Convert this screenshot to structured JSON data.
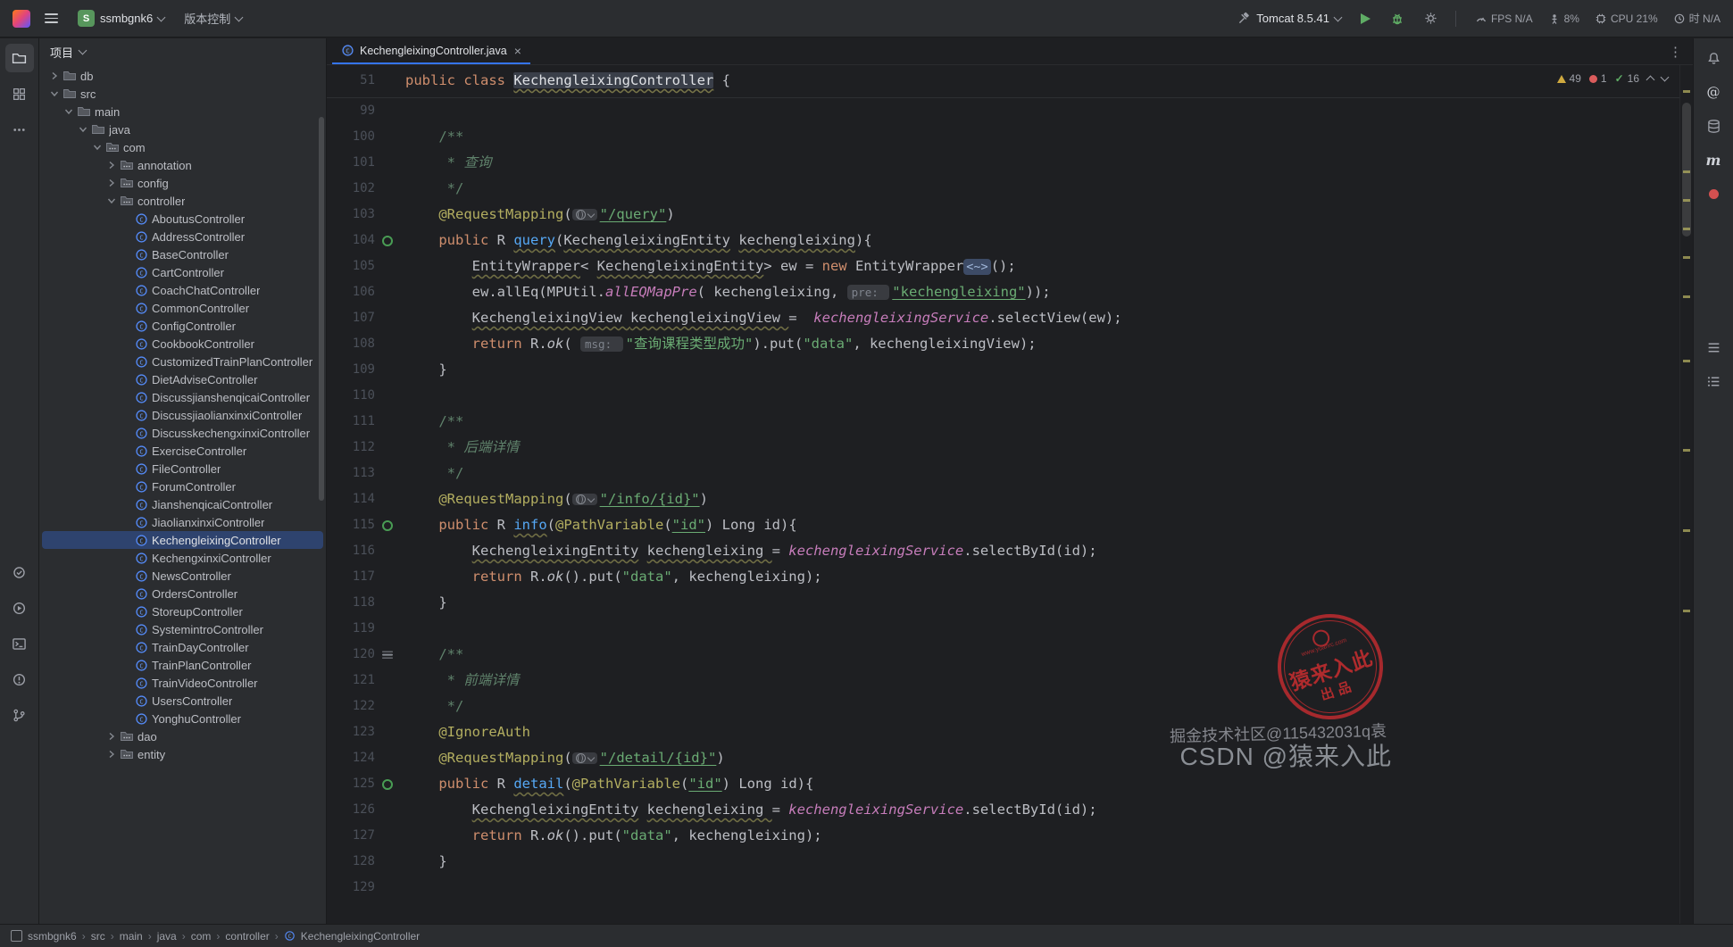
{
  "icons": {
    "close_tab": "×",
    "more_vertical": "⋮",
    "check": "✓",
    "maven": "m",
    "at": "@",
    "project_badge": "S"
  },
  "titlebar": {
    "project_name": "ssmbgnk6",
    "vcs_label": "版本控制",
    "run_config": "Tomcat 8.5.41",
    "perf": {
      "fps": "FPS N/A",
      "mem": "8%",
      "cpu": "CPU 21%",
      "time": "时 N/A"
    }
  },
  "project_panel": {
    "title": "项目",
    "tree": [
      {
        "label": "db",
        "level": 1,
        "kind": "folder",
        "state": "collapsed"
      },
      {
        "label": "src",
        "level": 1,
        "kind": "folder",
        "state": "expanded"
      },
      {
        "label": "main",
        "level": 2,
        "kind": "folder",
        "state": "expanded"
      },
      {
        "label": "java",
        "level": 3,
        "kind": "folder",
        "state": "expanded"
      },
      {
        "label": "com",
        "level": 4,
        "kind": "package",
        "state": "expanded"
      },
      {
        "label": "annotation",
        "level": 5,
        "kind": "package",
        "state": "collapsed"
      },
      {
        "label": "config",
        "level": 5,
        "kind": "package",
        "state": "collapsed"
      },
      {
        "label": "controller",
        "level": 5,
        "kind": "package",
        "state": "expanded"
      },
      {
        "label": "AboutusController",
        "level": 6,
        "kind": "class"
      },
      {
        "label": "AddressController",
        "level": 6,
        "kind": "class"
      },
      {
        "label": "BaseController",
        "level": 6,
        "kind": "class"
      },
      {
        "label": "CartController",
        "level": 6,
        "kind": "class"
      },
      {
        "label": "CoachChatController",
        "level": 6,
        "kind": "class"
      },
      {
        "label": "CommonController",
        "level": 6,
        "kind": "class"
      },
      {
        "label": "ConfigController",
        "level": 6,
        "kind": "class"
      },
      {
        "label": "CookbookController",
        "level": 6,
        "kind": "class"
      },
      {
        "label": "CustomizedTrainPlanController",
        "level": 6,
        "kind": "class"
      },
      {
        "label": "DietAdviseController",
        "level": 6,
        "kind": "class"
      },
      {
        "label": "DiscussjianshenqicaiController",
        "level": 6,
        "kind": "class"
      },
      {
        "label": "DiscussjiaolianxinxiController",
        "level": 6,
        "kind": "class"
      },
      {
        "label": "DiscusskechengxinxiController",
        "level": 6,
        "kind": "class"
      },
      {
        "label": "ExerciseController",
        "level": 6,
        "kind": "class"
      },
      {
        "label": "FileController",
        "level": 6,
        "kind": "class"
      },
      {
        "label": "ForumController",
        "level": 6,
        "kind": "class"
      },
      {
        "label": "JianshenqicaiController",
        "level": 6,
        "kind": "class"
      },
      {
        "label": "JiaolianxinxiController",
        "level": 6,
        "kind": "class"
      },
      {
        "label": "KechengleixingController",
        "level": 6,
        "kind": "class",
        "selected": true
      },
      {
        "label": "KechengxinxiController",
        "level": 6,
        "kind": "class"
      },
      {
        "label": "NewsController",
        "level": 6,
        "kind": "class"
      },
      {
        "label": "OrdersController",
        "level": 6,
        "kind": "class"
      },
      {
        "label": "StoreupController",
        "level": 6,
        "kind": "class"
      },
      {
        "label": "SystemintroController",
        "level": 6,
        "kind": "class"
      },
      {
        "label": "TrainDayController",
        "level": 6,
        "kind": "class"
      },
      {
        "label": "TrainPlanController",
        "level": 6,
        "kind": "class"
      },
      {
        "label": "TrainVideoController",
        "level": 6,
        "kind": "class"
      },
      {
        "label": "UsersController",
        "level": 6,
        "kind": "class"
      },
      {
        "label": "YonghuController",
        "level": 6,
        "kind": "class"
      },
      {
        "label": "dao",
        "level": 5,
        "kind": "package",
        "state": "collapsed"
      },
      {
        "label": "entity",
        "level": 5,
        "kind": "package",
        "state": "collapsed"
      }
    ]
  },
  "editor": {
    "tab_label": "KechengleixingController.java",
    "inspections": {
      "warnings": "49",
      "errors": "1",
      "passed": "16"
    },
    "sticky": {
      "n": "51",
      "segs": [
        [
          "public class ",
          "k"
        ],
        [
          "KechengleixingController",
          "ihl"
        ],
        [
          " {",
          "p"
        ]
      ]
    },
    "lines": [
      {
        "n": "99",
        "segs": []
      },
      {
        "n": "100",
        "segs": [
          [
            "    /**",
            "cm"
          ]
        ]
      },
      {
        "n": "101",
        "segs": [
          [
            "     * ",
            "cm"
          ],
          [
            "查询",
            "cmi"
          ]
        ]
      },
      {
        "n": "102",
        "segs": [
          [
            "     */",
            "cm"
          ]
        ]
      },
      {
        "n": "103",
        "segs": [
          [
            "    ",
            "p"
          ],
          [
            "@RequestMapping",
            "a"
          ],
          [
            "(",
            "p"
          ],
          [
            "",
            "ginlay"
          ],
          [
            "\"/query\"",
            "su"
          ],
          [
            ")",
            "p"
          ]
        ]
      },
      {
        "n": "104",
        "g": "api",
        "segs": [
          [
            "    ",
            "p"
          ],
          [
            "public ",
            "k"
          ],
          [
            "R ",
            "p"
          ],
          [
            "query",
            "mty"
          ],
          [
            "(",
            "p"
          ],
          [
            "KechengleixingEntity",
            "ty"
          ],
          [
            " ",
            "p"
          ],
          [
            "kechengleixing",
            "ty"
          ],
          [
            "){",
            "p"
          ]
        ]
      },
      {
        "n": "105",
        "segs": [
          [
            "        ",
            "p"
          ],
          [
            "EntityWrapper",
            "ty"
          ],
          [
            "< ",
            "p"
          ],
          [
            "KechengleixingEntity",
            "ty"
          ],
          [
            "> ",
            "p"
          ],
          [
            "ew ",
            "p"
          ],
          [
            "= ",
            "p"
          ],
          [
            "new ",
            "k"
          ],
          [
            "EntityWrapper",
            "p"
          ],
          [
            "<~>",
            "hintb"
          ],
          [
            "();",
            "p"
          ]
        ]
      },
      {
        "n": "106",
        "segs": [
          [
            "        ",
            "p"
          ],
          [
            "ew.allEq(",
            "p"
          ],
          [
            "MPUtil",
            "p"
          ],
          [
            ".",
            "p"
          ],
          [
            "allEQMapPre",
            "f"
          ],
          [
            "( ",
            "p"
          ],
          [
            "kechengleixing",
            "p"
          ],
          [
            ", ",
            "p"
          ],
          [
            "pre: ",
            "hint"
          ],
          [
            "\"kechengleixing\"",
            "su"
          ],
          [
            "));",
            "p"
          ]
        ]
      },
      {
        "n": "107",
        "segs": [
          [
            "        ",
            "p"
          ],
          [
            "KechengleixingView ",
            "ty"
          ],
          [
            "kechengleixingView ",
            "ty"
          ],
          [
            "=  ",
            "p"
          ],
          [
            "kechengleixingService",
            "f"
          ],
          [
            ".selectView(ew);",
            "p"
          ]
        ]
      },
      {
        "n": "108",
        "segs": [
          [
            "        ",
            "p"
          ],
          [
            "return ",
            "k"
          ],
          [
            "R.",
            "p"
          ],
          [
            "ok",
            "it"
          ],
          [
            "( ",
            "p"
          ],
          [
            "msg: ",
            "hint"
          ],
          [
            "\"查询课程类型成功\"",
            "s"
          ],
          [
            ").put(",
            "p"
          ],
          [
            "\"data\"",
            "s"
          ],
          [
            ", kechengleixingView);",
            "p"
          ]
        ]
      },
      {
        "n": "109",
        "segs": [
          [
            "    }",
            "p"
          ]
        ]
      },
      {
        "n": "110",
        "segs": []
      },
      {
        "n": "111",
        "segs": [
          [
            "    /**",
            "cm"
          ]
        ]
      },
      {
        "n": "112",
        "segs": [
          [
            "     * ",
            "cm"
          ],
          [
            "后端详情",
            "cmi"
          ]
        ]
      },
      {
        "n": "113",
        "segs": [
          [
            "     */",
            "cm"
          ]
        ]
      },
      {
        "n": "114",
        "segs": [
          [
            "    ",
            "p"
          ],
          [
            "@RequestMapping",
            "a"
          ],
          [
            "(",
            "p"
          ],
          [
            "",
            "ginlay"
          ],
          [
            "\"/info/{id}\"",
            "su"
          ],
          [
            ")",
            "p"
          ]
        ]
      },
      {
        "n": "115",
        "g": "api",
        "segs": [
          [
            "    ",
            "p"
          ],
          [
            "public ",
            "k"
          ],
          [
            "R ",
            "p"
          ],
          [
            "info",
            "mty"
          ],
          [
            "(",
            "p"
          ],
          [
            "@PathVariable",
            "a"
          ],
          [
            "(",
            "p"
          ],
          [
            "\"id\"",
            "su"
          ],
          [
            ") ",
            "p"
          ],
          [
            "Long ",
            "p"
          ],
          [
            "id",
            "p"
          ],
          [
            "){",
            "p"
          ]
        ]
      },
      {
        "n": "116",
        "segs": [
          [
            "        ",
            "p"
          ],
          [
            "KechengleixingEntity",
            "ty"
          ],
          [
            " ",
            "p"
          ],
          [
            "kechengleixing ",
            "ty"
          ],
          [
            "= ",
            "p"
          ],
          [
            "kechengleixingService",
            "f"
          ],
          [
            ".selectById(id);",
            "p"
          ]
        ]
      },
      {
        "n": "117",
        "segs": [
          [
            "        ",
            "p"
          ],
          [
            "return ",
            "k"
          ],
          [
            "R.",
            "p"
          ],
          [
            "ok",
            "it"
          ],
          [
            "().put(",
            "p"
          ],
          [
            "\"data\"",
            "s"
          ],
          [
            ", kechengleixing);",
            "p"
          ]
        ]
      },
      {
        "n": "118",
        "segs": [
          [
            "    }",
            "p"
          ]
        ]
      },
      {
        "n": "119",
        "segs": []
      },
      {
        "n": "120",
        "g": "menu",
        "segs": [
          [
            "    /**",
            "cm"
          ]
        ]
      },
      {
        "n": "121",
        "segs": [
          [
            "     * ",
            "cm"
          ],
          [
            "前端详情",
            "cmi"
          ]
        ]
      },
      {
        "n": "122",
        "segs": [
          [
            "     */",
            "cm"
          ]
        ]
      },
      {
        "n": "123",
        "segs": [
          [
            "    ",
            "p"
          ],
          [
            "@IgnoreAuth",
            "a"
          ]
        ]
      },
      {
        "n": "124",
        "segs": [
          [
            "    ",
            "p"
          ],
          [
            "@RequestMapping",
            "a"
          ],
          [
            "(",
            "p"
          ],
          [
            "",
            "ginlay"
          ],
          [
            "\"/detail/{id}\"",
            "su"
          ],
          [
            ")",
            "p"
          ]
        ]
      },
      {
        "n": "125",
        "g": "api",
        "segs": [
          [
            "    ",
            "p"
          ],
          [
            "public ",
            "k"
          ],
          [
            "R ",
            "p"
          ],
          [
            "detail",
            "mty"
          ],
          [
            "(",
            "p"
          ],
          [
            "@PathVariable",
            "a"
          ],
          [
            "(",
            "p"
          ],
          [
            "\"id\"",
            "su"
          ],
          [
            ") ",
            "p"
          ],
          [
            "Long id",
            "p"
          ],
          [
            "){",
            "p"
          ]
        ]
      },
      {
        "n": "126",
        "segs": [
          [
            "        ",
            "p"
          ],
          [
            "KechengleixingEntity",
            "ty"
          ],
          [
            " ",
            "p"
          ],
          [
            "kechengleixing ",
            "ty"
          ],
          [
            "= ",
            "p"
          ],
          [
            "kechengleixingService",
            "f"
          ],
          [
            ".selectById(id);",
            "p"
          ]
        ]
      },
      {
        "n": "127",
        "segs": [
          [
            "        ",
            "p"
          ],
          [
            "return ",
            "k"
          ],
          [
            "R.",
            "p"
          ],
          [
            "ok",
            "it"
          ],
          [
            "().put(",
            "p"
          ],
          [
            "\"data\"",
            "s"
          ],
          [
            ", kechengleixing);",
            "p"
          ]
        ]
      },
      {
        "n": "128",
        "segs": [
          [
            "    }",
            "p"
          ]
        ]
      },
      {
        "n": "129",
        "segs": []
      }
    ]
  },
  "statusbar": {
    "breadcrumbs": [
      "ssmbgnk6",
      "src",
      "main",
      "java",
      "com",
      "controller",
      "KechengleixingController"
    ]
  },
  "watermarks": {
    "line1": "掘金技术社区@115432031q袁",
    "line2": "CSDN @猿来入此",
    "stamp_main": "猿来入此",
    "stamp_sub": "出品",
    "stamp_url": "www.yuanrc.com"
  }
}
